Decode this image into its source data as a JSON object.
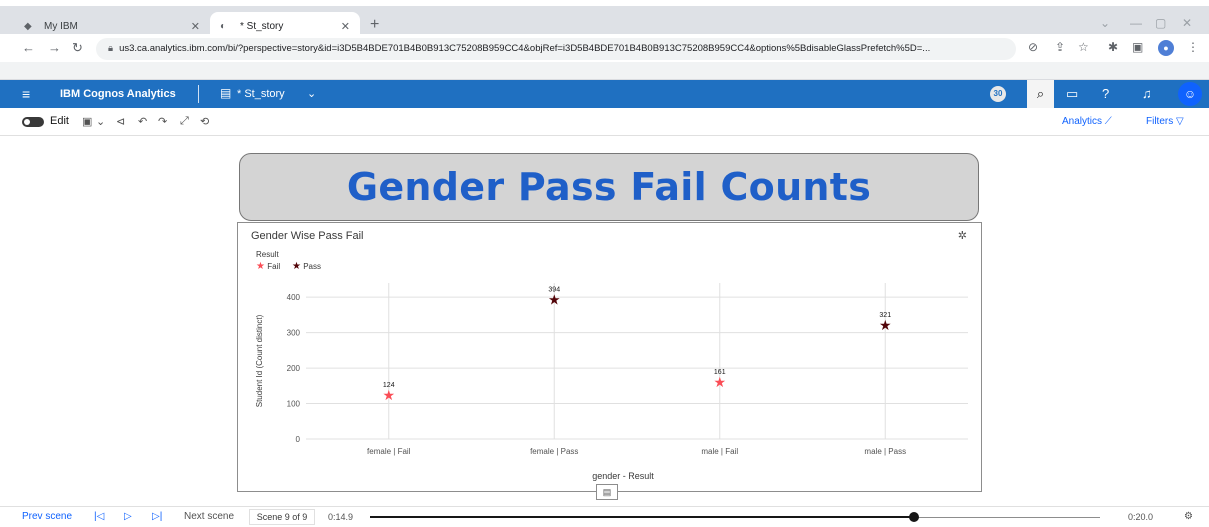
{
  "browser": {
    "tabs": [
      {
        "title": "My IBM",
        "icon": "ibm-icon"
      },
      {
        "title": "* St_story",
        "icon": "cognos-icon"
      }
    ],
    "url": "us3.ca.analytics.ibm.com/bi/?perspective=story&id=i3D5B4BDE701B4B0B913C75208B959CC4&objRef=i3D5B4BDE701B4B0B913C75208B959CC4&options%5BdisableGlassPrefetch%5D=..."
  },
  "cognos": {
    "brand": "IBM Cognos Analytics",
    "story_name": "* St_story",
    "badge": "30"
  },
  "toolbar": {
    "edit_label": "Edit",
    "analytics_label": "Analytics",
    "filters_label": "Filters"
  },
  "canvas": {
    "title": "Gender Pass Fail Counts"
  },
  "chart_data": {
    "type": "scatter",
    "title": "Gender Wise Pass Fail",
    "legend_title": "Result",
    "legend": [
      {
        "name": "Fail",
        "color": "#fa4d56"
      },
      {
        "name": "Pass",
        "color": "#520408"
      }
    ],
    "xlabel": "gender - Result",
    "ylabel": "Student Id (Count distinct)",
    "categories": [
      "female | Fail",
      "female | Pass",
      "male | Fail",
      "male | Pass"
    ],
    "yticks": [
      0,
      100,
      200,
      300,
      400
    ],
    "ylim": [
      0,
      440
    ],
    "points": [
      {
        "category": "female | Fail",
        "series": "Fail",
        "value": 124
      },
      {
        "category": "female | Pass",
        "series": "Pass",
        "value": 394
      },
      {
        "category": "male | Fail",
        "series": "Fail",
        "value": 161
      },
      {
        "category": "male | Pass",
        "series": "Pass",
        "value": 321
      }
    ],
    "grid": true,
    "legend_position": "top-left"
  },
  "playbar": {
    "prev": "Prev scene",
    "next": "Next scene",
    "scene": "Scene 9 of 9",
    "time_current": "0:14.9",
    "time_total": "0:20.0",
    "progress": 0.745
  }
}
